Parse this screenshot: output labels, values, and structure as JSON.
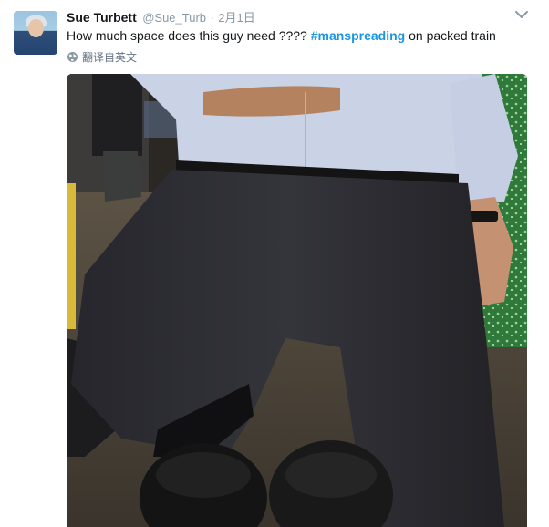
{
  "tweet": {
    "author_name": "Sue Turbett",
    "handle": "@Sue_Turb",
    "separator": "·",
    "timestamp": "2月1日",
    "text_before": "How much space does this guy need ???? ",
    "hashtag": "#manspreading",
    "text_after": " on packed train",
    "translate_label": "翻译自英文"
  },
  "icons": {
    "avatar": "avatar",
    "more": "chevron-down-icon",
    "translate": "globe-icon"
  },
  "colors": {
    "hashtag": "#1b95e0",
    "secondary_text": "#8899a6",
    "seat_green": "#2f7a3a"
  }
}
